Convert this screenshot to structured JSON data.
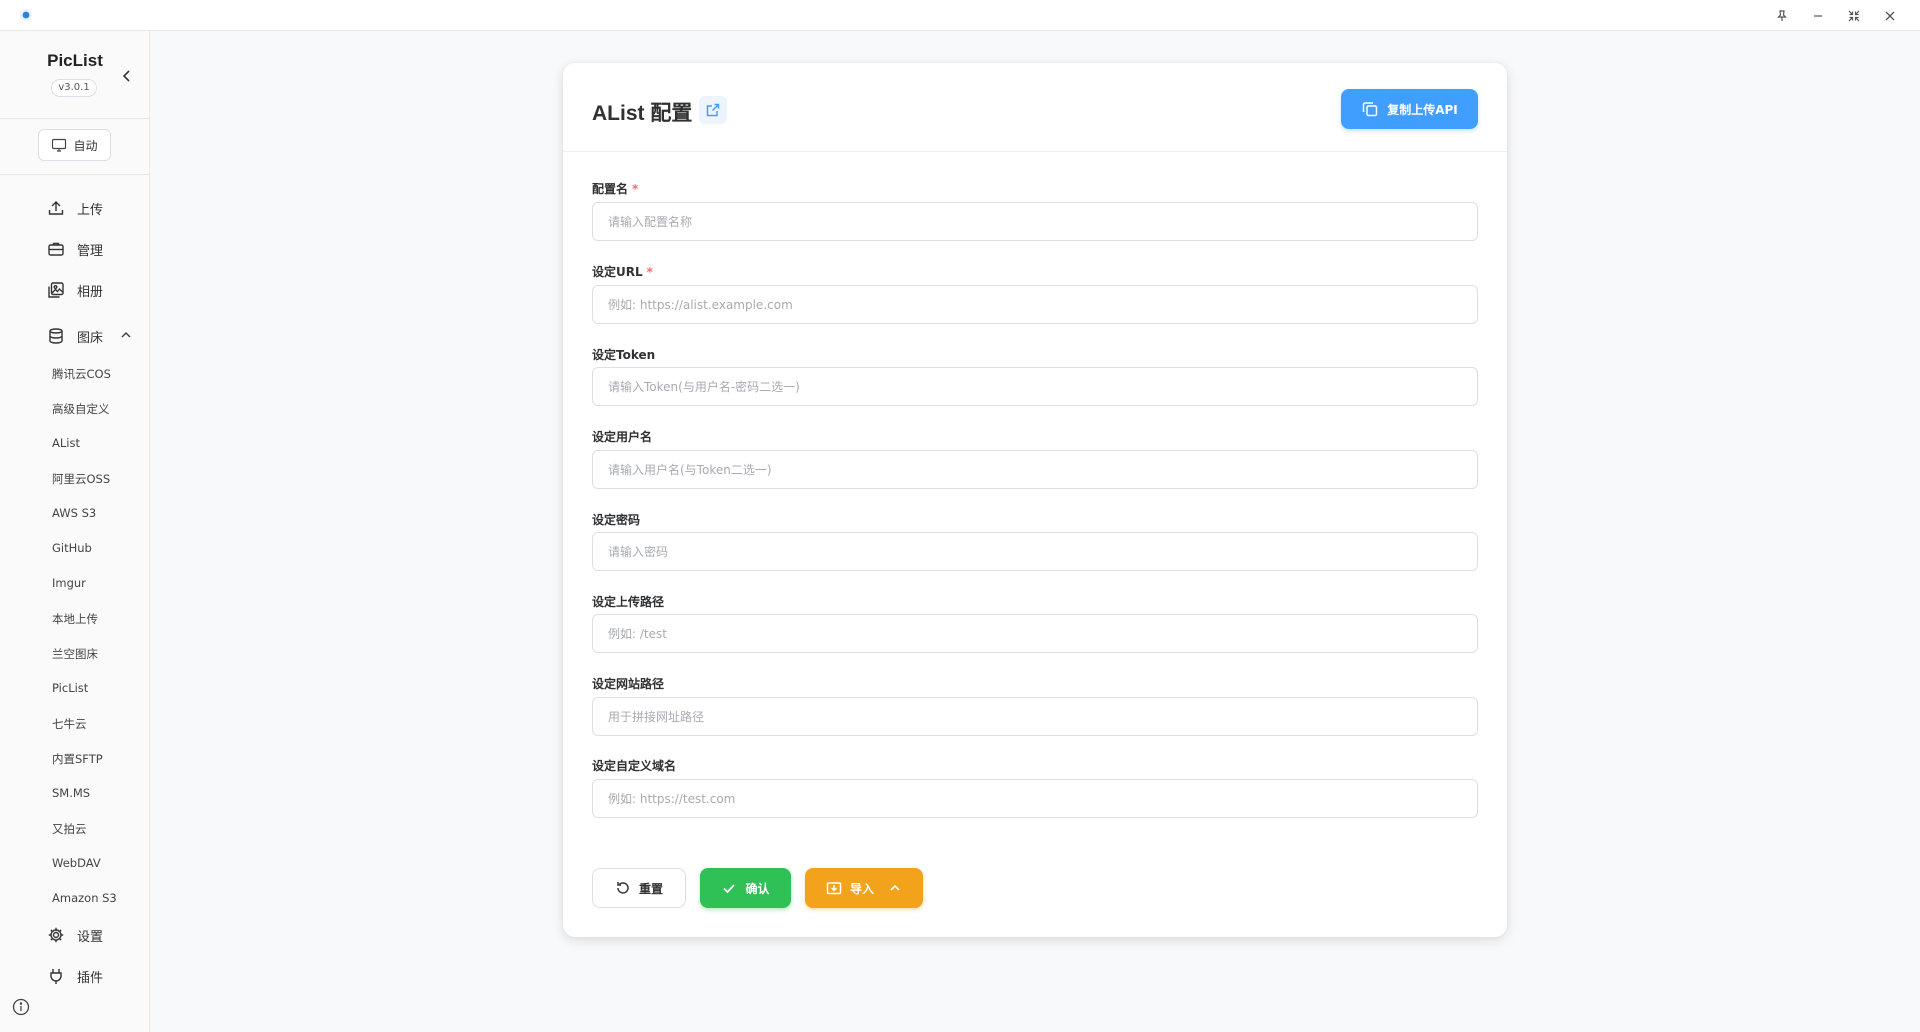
{
  "sidebar": {
    "brand": "PicList",
    "version": "v3.0.1",
    "mode_label": "自动",
    "nav": {
      "upload": "上传",
      "manage": "管理",
      "gallery": "相册",
      "hosts": "图床",
      "settings": "设置",
      "plugins": "插件"
    },
    "host_items": [
      "腾讯云COS",
      "高级自定义",
      "AList",
      "阿里云OSS",
      "AWS S3",
      "GitHub",
      "Imgur",
      "本地上传",
      "兰空图床",
      "PicList",
      "七牛云",
      "内置SFTP",
      "SM.MS",
      "又拍云",
      "WebDAV",
      "Amazon S3"
    ]
  },
  "card": {
    "title": "AList 配置",
    "copy_api_label": "复制上传API",
    "fields": [
      {
        "label": "配置名",
        "required": true,
        "placeholder": "请输入配置名称"
      },
      {
        "label": "设定URL",
        "required": true,
        "placeholder": "例如: https://alist.example.com"
      },
      {
        "label": "设定Token",
        "required": false,
        "placeholder": "请输入Token(与用户名-密码二选一)"
      },
      {
        "label": "设定用户名",
        "required": false,
        "placeholder": "请输入用户名(与Token二选一)"
      },
      {
        "label": "设定密码",
        "required": false,
        "placeholder": "请输入密码"
      },
      {
        "label": "设定上传路径",
        "required": false,
        "placeholder": "例如: /test"
      },
      {
        "label": "设定网站路径",
        "required": false,
        "placeholder": "用于拼接网址路径"
      },
      {
        "label": "设定自定义域名",
        "required": false,
        "placeholder": "例如: https://test.com"
      }
    ],
    "required_mark": "*",
    "buttons": {
      "reset": "重置",
      "confirm": "确认",
      "import": "导入"
    }
  },
  "colors": {
    "primary": "#409eff",
    "success": "#2fc155",
    "warning": "#f2a21b",
    "danger": "#f56c6c"
  },
  "icons": [
    "app-logo-icon",
    "pin-icon",
    "minimize-icon",
    "restore-icon",
    "close-icon",
    "chevron-left-icon",
    "monitor-icon",
    "upload-icon",
    "briefcase-icon",
    "images-icon",
    "database-icon",
    "chevron-up-icon",
    "gear-icon",
    "plug-icon",
    "info-icon",
    "external-link-icon",
    "copy-icon",
    "refresh-icon",
    "check-icon",
    "download-icon"
  ]
}
